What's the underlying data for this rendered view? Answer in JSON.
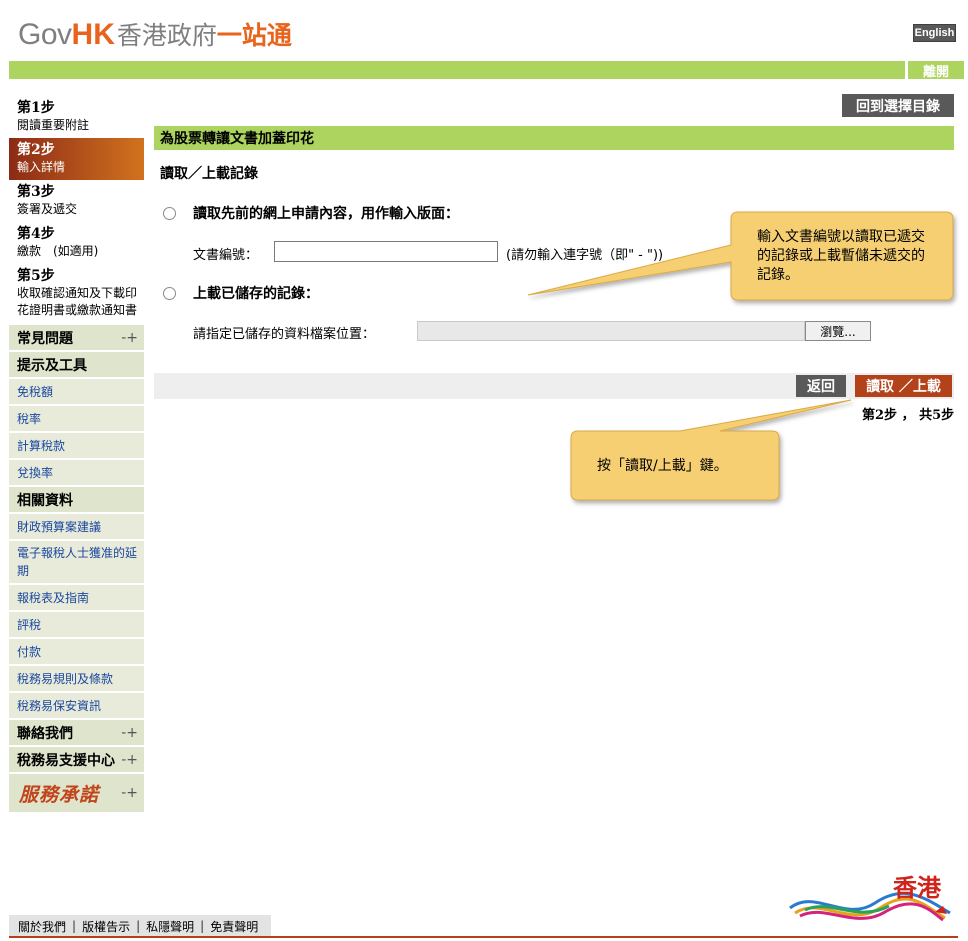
{
  "header": {
    "logo_gov": "Gov",
    "logo_hk": "HK",
    "logo_cn_part1": "香港政府",
    "logo_cn_part2": "一站通",
    "language_button": "English",
    "leave_button": "離開"
  },
  "sidebar": {
    "steps": [
      {
        "num": "第1步",
        "desc": "閱讀重要附註"
      },
      {
        "num": "第2步",
        "desc": "輸入詳情"
      },
      {
        "num": "第3步",
        "desc": "簽署及遞交"
      },
      {
        "num": "第4步",
        "desc": "繳款　(如適用)"
      },
      {
        "num": "第5步",
        "desc": "收取確認通知及下載印花證明書或繳款通知書"
      }
    ],
    "faq": "常見問題",
    "tips_tools": "提示及工具",
    "tips_items": [
      "免稅額",
      "稅率",
      "計算稅款",
      "兌換率"
    ],
    "related_info": "相關資料",
    "related_items": [
      "財政預算案建議",
      "電子報稅人士獲准的延期",
      "報稅表及指南",
      "評稅",
      "付款",
      "稅務易規則及條款",
      "稅務易保安資訊"
    ],
    "contact_us": "聯絡我們",
    "support_centre": "稅務易支援中心",
    "service_promise": "服務承諾",
    "plus_icon": "plus-arrow-icon"
  },
  "main": {
    "back_to_menu": "回到選擇目錄",
    "section_title": "為股票轉讓文書加蓋印花",
    "sub_title": "讀取／上載記錄",
    "option1_label": "讀取先前的網上申請內容，用作輸入版面：",
    "doc_no_label": "文書編號：",
    "doc_no_value": "",
    "doc_no_hint": "(請勿輸入連字號（即\" - \"))",
    "option2_label": "上載已儲存的記錄：",
    "file_label": "請指定已儲存的資料檔案位置：",
    "file_value": "",
    "browse_button": "瀏覽...",
    "back_button": "返回",
    "submit_button": "讀取 ／上載",
    "step_counter": "第2步 ， 共5步"
  },
  "callouts": {
    "callout1": "輸入文書編號以讀取已遞交的記錄或上載暫儲未遞交的記錄。",
    "callout2": "按「讀取/上載」鍵。",
    "fill_color": "#f6cf72"
  },
  "footer": {
    "links": [
      "關於我們",
      "版權告示",
      "私隱聲明",
      "免責聲明"
    ],
    "brand_text": "香港"
  }
}
